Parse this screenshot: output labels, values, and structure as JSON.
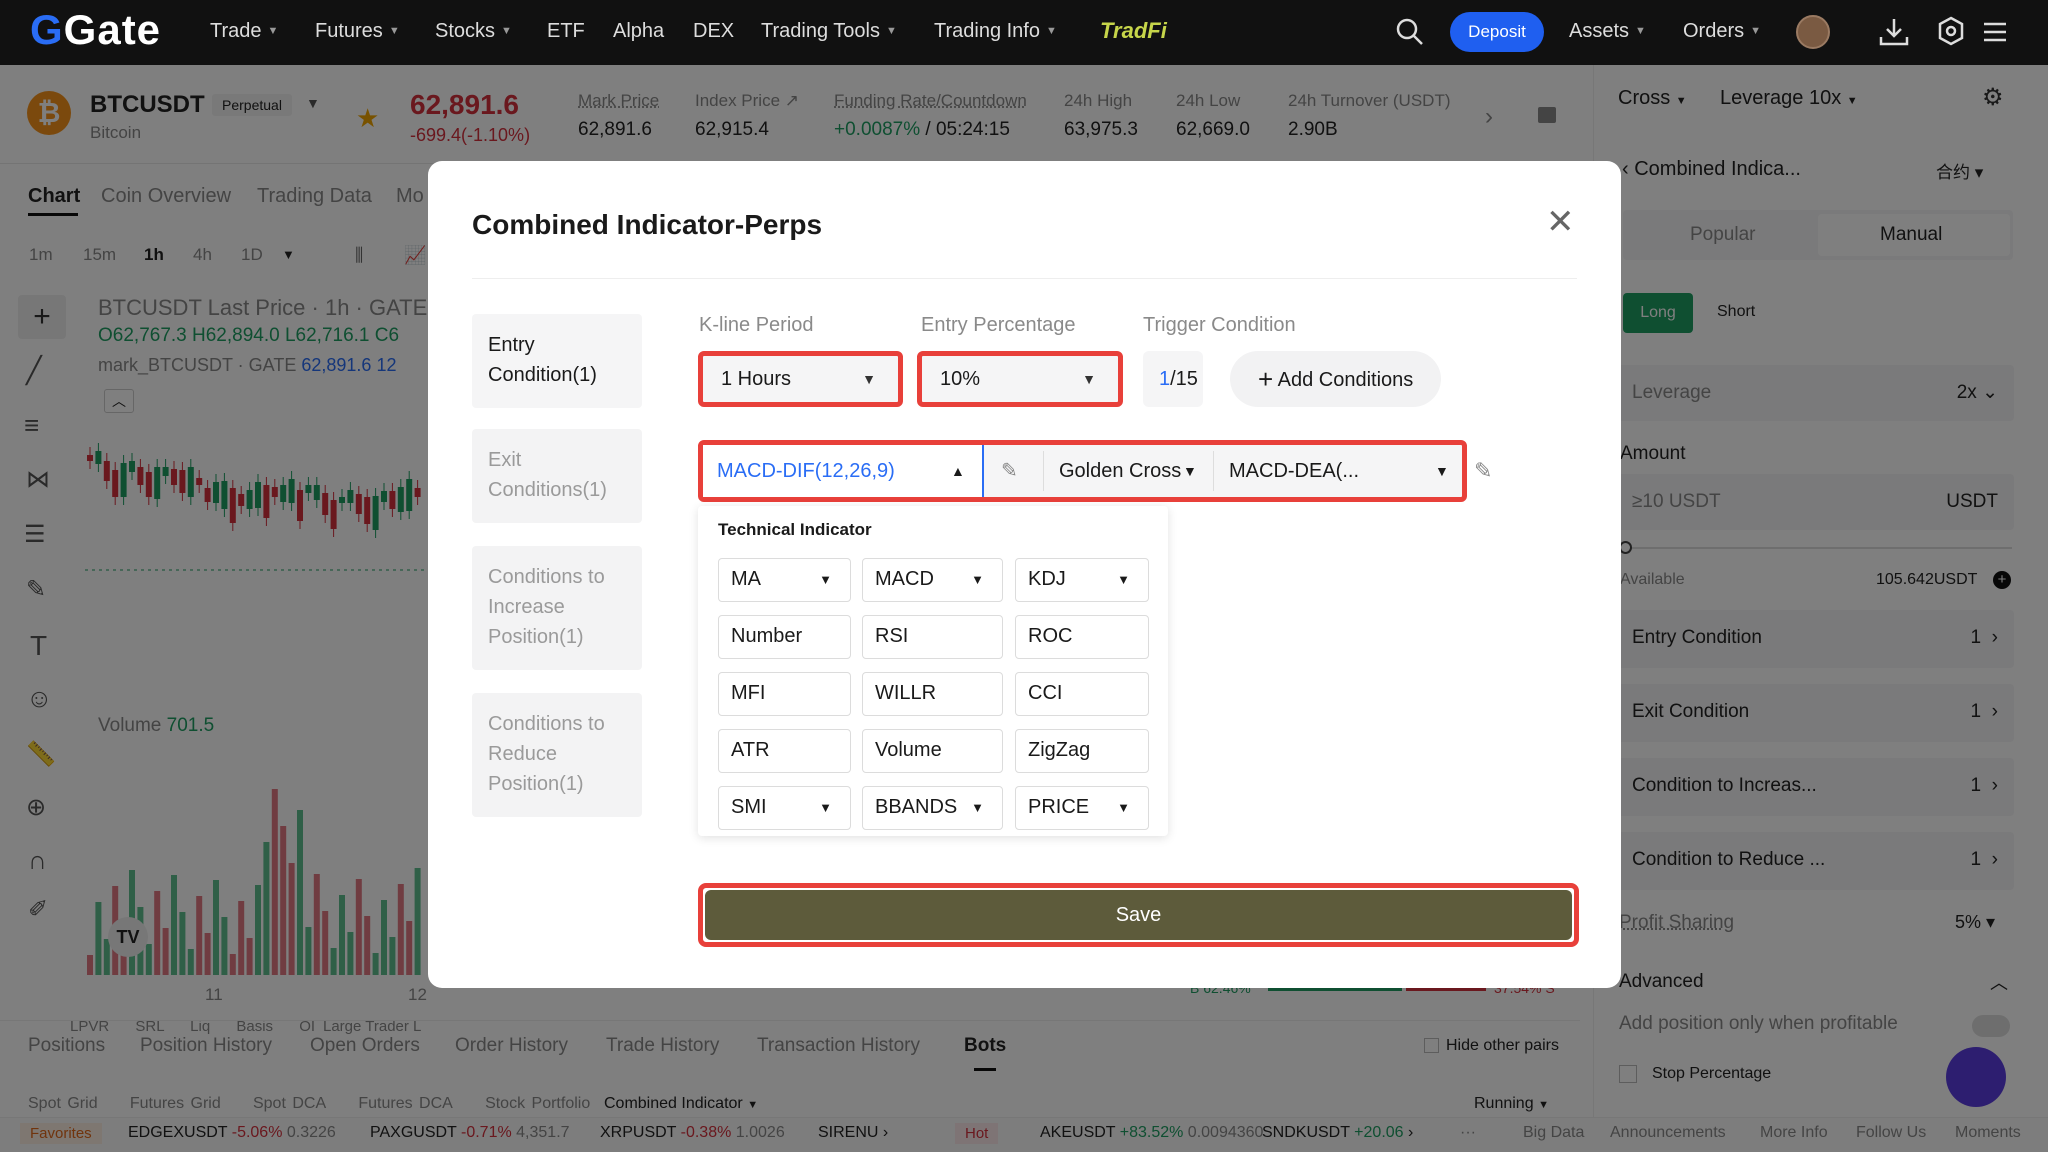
{
  "nav": {
    "logo": "Gate",
    "items": [
      "Trade",
      "Futures",
      "Stocks",
      "ETF",
      "Alpha",
      "DEX",
      "Trading Tools",
      "Trading Info"
    ],
    "tradfi": "TradFi",
    "deposit": "Deposit",
    "assets": "Assets",
    "orders": "Orders"
  },
  "ticker": {
    "symbol": "BTCUSDT",
    "type": "Perpetual",
    "name": "Bitcoin",
    "price": "62,891.6",
    "change": "-699.4(-1.10%)",
    "stats": [
      {
        "label": "Mark Price",
        "value": "62,891.6"
      },
      {
        "label": "Index Price",
        "value": "62,915.4"
      },
      {
        "label": "Funding Rate/Countdown",
        "value": "+0.0087%",
        "value2": "/ 05:24:15"
      },
      {
        "label": "24h High",
        "value": "63,975.3"
      },
      {
        "label": "24h Low",
        "value": "62,669.0"
      },
      {
        "label": "24h Turnover (USDT)",
        "value": "2.90B"
      }
    ]
  },
  "chart_tabs": [
    "Chart",
    "Coin Overview",
    "Trading Data",
    "Mo"
  ],
  "intervals": [
    "1m",
    "15m",
    "1h",
    "4h",
    "1D"
  ],
  "chart_info": {
    "title": "BTCUSDT Last Price · 1h · GATE",
    "ohlc": "O62,767.3 H62,894.0 L62,716.1 C6",
    "mark_label": "mark_BTCUSDT · GATE",
    "mark_value": "62,891.6",
    "mark_extra": "12",
    "volume_label": "Volume",
    "volume_value": "701.5",
    "x_ticks": [
      "11",
      "12"
    ],
    "bottom_tools": [
      "LPVR",
      "SRL",
      "Liq",
      "Basis",
      "OI",
      "Large Trader L"
    ]
  },
  "bottom": {
    "tabs": [
      "Positions",
      "Position History",
      "Open Orders",
      "Order History",
      "Trade History",
      "Transaction History",
      "Bots"
    ],
    "hide_other": "Hide other pairs",
    "subtabs": [
      "Spot Grid",
      "Futures Grid",
      "Spot DCA",
      "Futures DCA",
      "Stock Portfolio",
      "Combined Indicator"
    ],
    "status": "Running",
    "ratio_left": "B 62.46%",
    "ratio_right": "37.54% S"
  },
  "ticker_bar": {
    "favorites": "Favorites",
    "items": [
      {
        "sym": "EDGEXUSDT",
        "chg": "-5.06%",
        "px": "0.3226"
      },
      {
        "sym": "PAXGUSDT",
        "chg": "-0.71%",
        "px": "4,351.7"
      },
      {
        "sym": "XRPUSDT",
        "chg": "-0.38%",
        "px": "1.0026"
      },
      {
        "sym": "SIRENU",
        "chg": "",
        "px": ""
      }
    ],
    "hot": "Hot",
    "hot_items": [
      {
        "sym": "AKEUSDT",
        "chg": "+83.52%",
        "px": "0.0094360"
      },
      {
        "sym": "SNDKUSDT",
        "chg": "+20.06",
        "px": ""
      }
    ],
    "links": [
      "Big Data",
      "Announcements",
      "More Info",
      "Follow Us",
      "Moments"
    ]
  },
  "right": {
    "cross": "Cross",
    "leverage_sel": "Leverage 10x",
    "back_title": "Combined Indica...",
    "lang": "合约",
    "tabs": [
      "Popular",
      "Manual"
    ],
    "long": "Long",
    "short": "Short",
    "leverage_label": "Leverage",
    "leverage_value": "2x",
    "amount_label": "Amount",
    "amount_placeholder": "≥10 USDT",
    "amount_unit": "USDT",
    "available_label": "Available",
    "available_value": "105.642USDT",
    "rows": [
      {
        "label": "Entry Condition",
        "value": "1"
      },
      {
        "label": "Exit Condition",
        "value": "1"
      },
      {
        "label": "Condition to Increas...",
        "value": "1"
      },
      {
        "label": "Condition to Reduce ...",
        "value": "1"
      }
    ],
    "profit_label": "Profit Sharing",
    "profit_value": "5%",
    "advanced": "Advanced",
    "add_profitable": "Add position only when profitable",
    "stop_pct": "Stop Percentage"
  },
  "modal": {
    "title": "Combined Indicator-Perps",
    "side": [
      {
        "l1": "Entry",
        "l2": "Condition(1)"
      },
      {
        "l1": "Exit",
        "l2": "Conditions(1)"
      },
      {
        "l1": "Conditions to",
        "l2": "Increase",
        "l3": "Position(1)"
      },
      {
        "l1": "Conditions to",
        "l2": "Reduce",
        "l3": "Position(1)"
      }
    ],
    "kline_label": "K-line Period",
    "kline_value": "1 Hours",
    "entry_label": "Entry Percentage",
    "entry_value": "10%",
    "trigger_label": "Trigger Condition",
    "trigger_cur": "1",
    "trigger_total": "/15",
    "add_conditions": "Add Conditions",
    "indicator_a": "MACD-DIF(12,26,9)",
    "operator": "Golden Cross",
    "indicator_b": "MACD-DEA(...",
    "tech_header": "Technical Indicator",
    "chips": [
      {
        "t": "MA",
        "dd": true
      },
      {
        "t": "MACD",
        "dd": true
      },
      {
        "t": "KDJ",
        "dd": true
      },
      {
        "t": "Number",
        "dd": false
      },
      {
        "t": "RSI",
        "dd": false
      },
      {
        "t": "ROC",
        "dd": false
      },
      {
        "t": "MFI",
        "dd": false
      },
      {
        "t": "WILLR",
        "dd": false
      },
      {
        "t": "CCI",
        "dd": false
      },
      {
        "t": "ATR",
        "dd": false
      },
      {
        "t": "Volume",
        "dd": false
      },
      {
        "t": "ZigZag",
        "dd": false
      },
      {
        "t": "SMI",
        "dd": true
      },
      {
        "t": "BBANDS",
        "dd": true
      },
      {
        "t": "PRICE",
        "dd": true
      }
    ],
    "save": "Save"
  }
}
